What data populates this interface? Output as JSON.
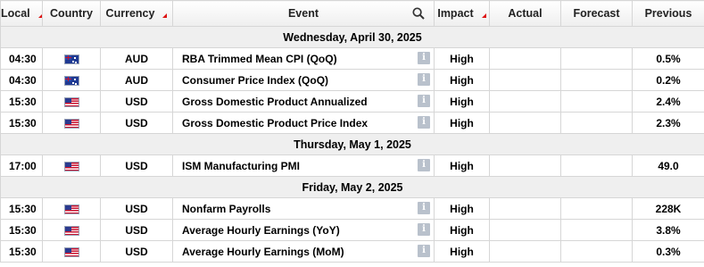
{
  "header": {
    "local": "Local",
    "country": "Country",
    "currency": "Currency",
    "event": "Event",
    "impact": "Impact",
    "actual": "Actual",
    "forecast": "Forecast",
    "previous": "Previous"
  },
  "info_glyph": "i",
  "colors": {
    "sort_marker": "#dd1111",
    "day_row_bg": "#efefef",
    "info_icon": "#b9c1cc"
  },
  "days": [
    {
      "label": "Wednesday, April 30, 2025",
      "events": [
        {
          "time": "04:30",
          "flag": "australia-flag-icon",
          "currency": "AUD",
          "event": "RBA Trimmed Mean CPI (QoQ)",
          "impact": "High",
          "actual": "",
          "forecast": "",
          "previous": "0.5%"
        },
        {
          "time": "04:30",
          "flag": "australia-flag-icon",
          "currency": "AUD",
          "event": "Consumer Price Index (QoQ)",
          "impact": "High",
          "actual": "",
          "forecast": "",
          "previous": "0.2%"
        },
        {
          "time": "15:30",
          "flag": "usa-flag-icon",
          "currency": "USD",
          "event": "Gross Domestic Product Annualized",
          "impact": "High",
          "actual": "",
          "forecast": "",
          "previous": "2.4%"
        },
        {
          "time": "15:30",
          "flag": "usa-flag-icon",
          "currency": "USD",
          "event": "Gross Domestic Product Price Index",
          "impact": "High",
          "actual": "",
          "forecast": "",
          "previous": "2.3%"
        }
      ]
    },
    {
      "label": "Thursday, May 1, 2025",
      "events": [
        {
          "time": "17:00",
          "flag": "usa-flag-icon",
          "currency": "USD",
          "event": "ISM Manufacturing PMI",
          "impact": "High",
          "actual": "",
          "forecast": "",
          "previous": "49.0"
        }
      ]
    },
    {
      "label": "Friday, May 2, 2025",
      "events": [
        {
          "time": "15:30",
          "flag": "usa-flag-icon",
          "currency": "USD",
          "event": "Nonfarm Payrolls",
          "impact": "High",
          "actual": "",
          "forecast": "",
          "previous": "228K"
        },
        {
          "time": "15:30",
          "flag": "usa-flag-icon",
          "currency": "USD",
          "event": "Average Hourly Earnings (YoY)",
          "impact": "High",
          "actual": "",
          "forecast": "",
          "previous": "3.8%"
        },
        {
          "time": "15:30",
          "flag": "usa-flag-icon",
          "currency": "USD",
          "event": "Average Hourly Earnings (MoM)",
          "impact": "High",
          "actual": "",
          "forecast": "",
          "previous": "0.3%"
        }
      ]
    }
  ]
}
